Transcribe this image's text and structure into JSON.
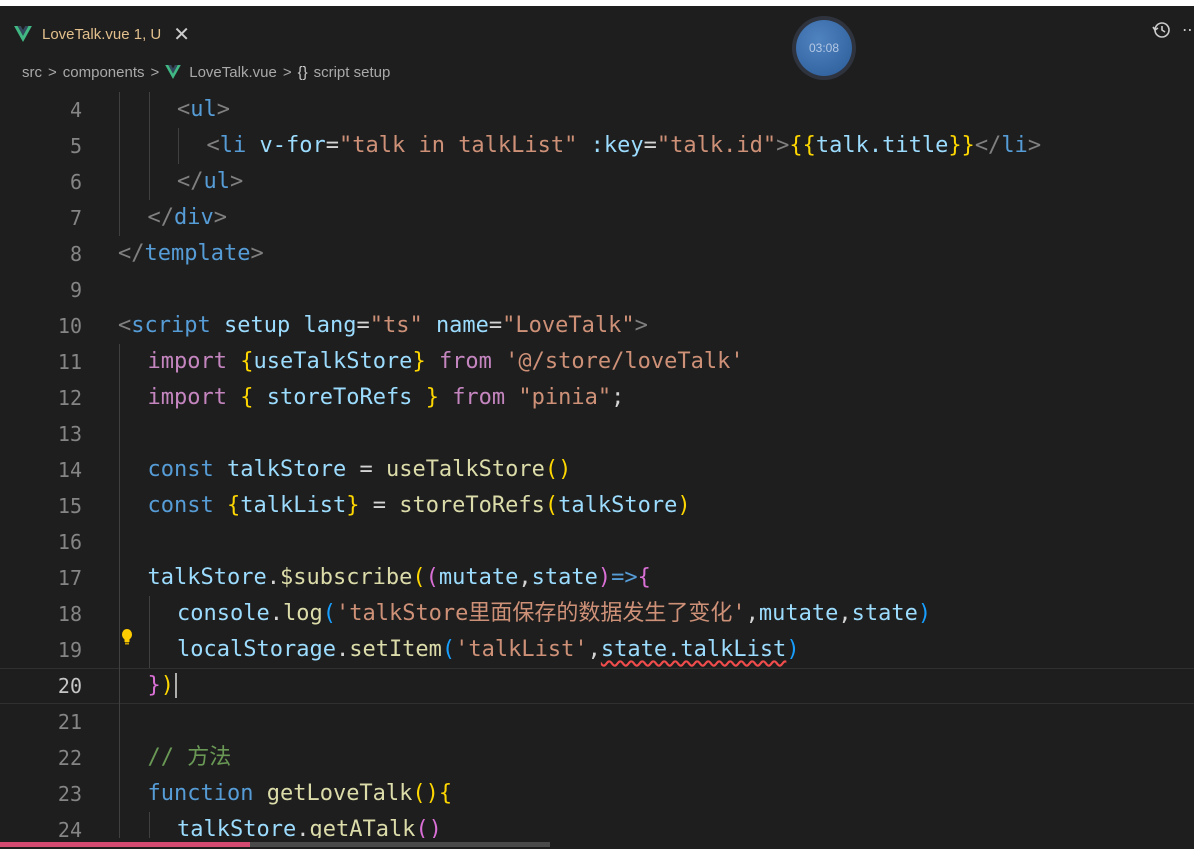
{
  "tab": {
    "label": "LoveTalk.vue 1, U",
    "close": "✕"
  },
  "timer": "03:08",
  "breadcrumb": {
    "src": "src",
    "components": "components",
    "file": "LoveTalk.vue",
    "braces": "{}",
    "symbol": "script setup",
    "sep": ">"
  },
  "lines": [
    {
      "n": "4",
      "indent": 2,
      "tokens": [
        [
          "br",
          "<"
        ],
        [
          "tag",
          "ul"
        ],
        [
          "br",
          ">"
        ]
      ]
    },
    {
      "n": "5",
      "indent": 3,
      "tokens": [
        [
          "br",
          "<"
        ],
        [
          "tag",
          "li"
        ],
        [
          "plain",
          " "
        ],
        [
          "attr",
          "v-for"
        ],
        [
          "plain",
          "="
        ],
        [
          "str",
          "\"talk in talkList\""
        ],
        [
          "plain",
          " "
        ],
        [
          "attr",
          ":key"
        ],
        [
          "plain",
          "="
        ],
        [
          "str",
          "\"talk.id\""
        ],
        [
          "br",
          ">"
        ],
        [
          "b1",
          "{{"
        ],
        [
          "var",
          "talk.title"
        ],
        [
          "b1",
          "}}"
        ],
        [
          "br",
          "</"
        ],
        [
          "tag",
          "li"
        ],
        [
          "br",
          ">"
        ]
      ]
    },
    {
      "n": "6",
      "indent": 2,
      "tokens": [
        [
          "br",
          "</"
        ],
        [
          "tag",
          "ul"
        ],
        [
          "br",
          ">"
        ]
      ]
    },
    {
      "n": "7",
      "indent": 1,
      "tokens": [
        [
          "br",
          "</"
        ],
        [
          "tag",
          "div"
        ],
        [
          "br",
          ">"
        ]
      ]
    },
    {
      "n": "8",
      "indent": 0,
      "tokens": [
        [
          "br",
          "</"
        ],
        [
          "tag",
          "template"
        ],
        [
          "br",
          ">"
        ]
      ]
    },
    {
      "n": "9",
      "indent": 0,
      "tokens": []
    },
    {
      "n": "10",
      "indent": 0,
      "tokens": [
        [
          "br",
          "<"
        ],
        [
          "tag",
          "script"
        ],
        [
          "plain",
          " "
        ],
        [
          "attr",
          "setup"
        ],
        [
          "plain",
          " "
        ],
        [
          "attr",
          "lang"
        ],
        [
          "plain",
          "="
        ],
        [
          "str",
          "\"ts\""
        ],
        [
          "plain",
          " "
        ],
        [
          "attr",
          "name"
        ],
        [
          "plain",
          "="
        ],
        [
          "str",
          "\"LoveTalk\""
        ],
        [
          "br",
          ">"
        ]
      ]
    },
    {
      "n": "11",
      "indent": 1,
      "tokens": [
        [
          "kw2",
          "import"
        ],
        [
          "plain",
          " "
        ],
        [
          "b1",
          "{"
        ],
        [
          "var",
          "useTalkStore"
        ],
        [
          "b1",
          "}"
        ],
        [
          "plain",
          " "
        ],
        [
          "kw2",
          "from"
        ],
        [
          "plain",
          " "
        ],
        [
          "str",
          "'@/store/loveTalk'"
        ]
      ]
    },
    {
      "n": "12",
      "indent": 1,
      "tokens": [
        [
          "kw2",
          "import"
        ],
        [
          "plain",
          " "
        ],
        [
          "b1",
          "{"
        ],
        [
          "plain",
          " "
        ],
        [
          "var",
          "storeToRefs"
        ],
        [
          "plain",
          " "
        ],
        [
          "b1",
          "}"
        ],
        [
          "plain",
          " "
        ],
        [
          "kw2",
          "from"
        ],
        [
          "plain",
          " "
        ],
        [
          "str",
          "\"pinia\""
        ],
        [
          "plain",
          ";"
        ]
      ]
    },
    {
      "n": "13",
      "indent": 1,
      "tokens": []
    },
    {
      "n": "14",
      "indent": 1,
      "tokens": [
        [
          "kw",
          "const"
        ],
        [
          "plain",
          " "
        ],
        [
          "var",
          "talkStore"
        ],
        [
          "plain",
          " = "
        ],
        [
          "fn",
          "useTalkStore"
        ],
        [
          "b1",
          "()"
        ]
      ]
    },
    {
      "n": "15",
      "indent": 1,
      "tokens": [
        [
          "kw",
          "const"
        ],
        [
          "plain",
          " "
        ],
        [
          "b1",
          "{"
        ],
        [
          "var",
          "talkList"
        ],
        [
          "b1",
          "}"
        ],
        [
          "plain",
          " = "
        ],
        [
          "fn",
          "storeToRefs"
        ],
        [
          "b1",
          "("
        ],
        [
          "var",
          "talkStore"
        ],
        [
          "b1",
          ")"
        ]
      ]
    },
    {
      "n": "16",
      "indent": 1,
      "tokens": []
    },
    {
      "n": "17",
      "indent": 1,
      "tokens": [
        [
          "var",
          "talkStore"
        ],
        [
          "plain",
          "."
        ],
        [
          "fn",
          "$subscribe"
        ],
        [
          "b1",
          "("
        ],
        [
          "b2",
          "("
        ],
        [
          "var",
          "mutate"
        ],
        [
          "plain",
          ","
        ],
        [
          "var",
          "state"
        ],
        [
          "b2",
          ")"
        ],
        [
          "kw",
          "=>"
        ],
        [
          "b2",
          "{"
        ]
      ]
    },
    {
      "n": "18",
      "indent": 2,
      "tokens": [
        [
          "var",
          "console"
        ],
        [
          "plain",
          "."
        ],
        [
          "fn",
          "log"
        ],
        [
          "b3",
          "("
        ],
        [
          "str",
          "'talkStore里面保存的数据发生了变化'"
        ],
        [
          "plain",
          ","
        ],
        [
          "var",
          "mutate"
        ],
        [
          "plain",
          ","
        ],
        [
          "var",
          "state"
        ],
        [
          "b3",
          ")"
        ]
      ]
    },
    {
      "n": "19",
      "indent": 2,
      "tokens": [
        [
          "var",
          "localStorage"
        ],
        [
          "plain",
          "."
        ],
        [
          "fn",
          "setItem"
        ],
        [
          "b3",
          "("
        ],
        [
          "str",
          "'talkList'"
        ],
        [
          "plain",
          ","
        ],
        [
          "squig",
          "state.talkList"
        ],
        [
          "b3",
          ")"
        ]
      ]
    },
    {
      "n": "20",
      "indent": 1,
      "active": true,
      "tokens": [
        [
          "b2",
          "}"
        ],
        [
          "b1",
          ")"
        ]
      ]
    },
    {
      "n": "21",
      "indent": 1,
      "tokens": []
    },
    {
      "n": "22",
      "indent": 1,
      "tokens": [
        [
          "cmt",
          "// 方法"
        ]
      ]
    },
    {
      "n": "23",
      "indent": 1,
      "tokens": [
        [
          "kw",
          "function"
        ],
        [
          "plain",
          " "
        ],
        [
          "fn",
          "getLoveTalk"
        ],
        [
          "b1",
          "(){"
        ]
      ]
    },
    {
      "n": "24",
      "indent": 2,
      "tokens": [
        [
          "var",
          "talkStore"
        ],
        [
          "plain",
          "."
        ],
        [
          "fn",
          "getATalk"
        ],
        [
          "b2",
          "()"
        ]
      ]
    }
  ]
}
